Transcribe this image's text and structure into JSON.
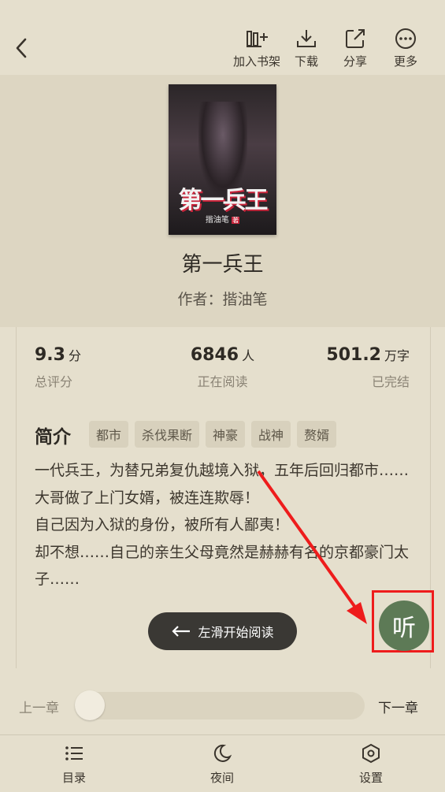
{
  "toolbar": {
    "add_shelf": "加入书架",
    "download": "下载",
    "share": "分享",
    "more": "更多"
  },
  "cover": {
    "title": "第一兵王",
    "author": "揩油笔",
    "author_badge": "著"
  },
  "book": {
    "title": "第一兵王",
    "author_label": "作者：揩油笔"
  },
  "stats": [
    {
      "value": "9.3",
      "unit": "分",
      "caption": "总评分"
    },
    {
      "value": "6846",
      "unit": "人",
      "caption": "正在阅读"
    },
    {
      "value": "501.2",
      "unit": "万字",
      "caption": "已完结"
    }
  ],
  "intro": {
    "heading": "简介",
    "tags": [
      "都市",
      "杀伐果断",
      "神豪",
      "战神",
      "赘婿"
    ],
    "lines": [
      "一代兵王，为替兄弟复仇越境入狱，五年后回归都市……",
      "大哥做了上门女婿，被连连欺辱！",
      "自己因为入狱的身份，被所有人鄙夷！",
      "却不想……自己的亲生父母竟然是赫赫有名的京都豪门太子……"
    ]
  },
  "swipe_button": "左滑开始阅读",
  "listen_button": "听",
  "chapter_nav": {
    "prev": "上一章",
    "next": "下一章",
    "progress": 0
  },
  "bottom_nav": {
    "toc": "目录",
    "night": "夜间",
    "settings": "设置"
  },
  "colors": {
    "background": "#e5dfcd",
    "card": "#ddd6c2",
    "listen": "#5d7a56",
    "highlight": "#ee1c1c"
  }
}
